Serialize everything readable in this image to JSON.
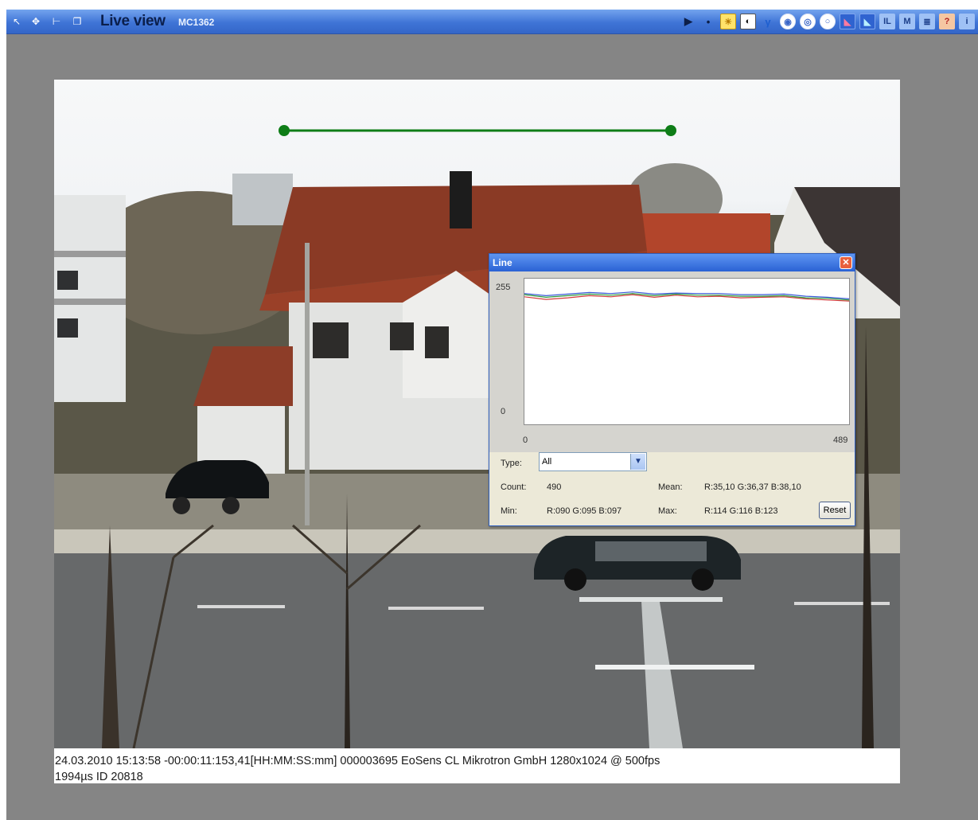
{
  "window": {
    "title": "Live view",
    "subtitle": "MC1362"
  },
  "toolbar_left": {
    "icons": [
      "pointer-icon",
      "move-icon",
      "line-measure-icon",
      "window-icon"
    ]
  },
  "toolbar_right": {
    "icons": [
      "play-icon",
      "record-dot-icon",
      "brightness-icon",
      "contrast-icon",
      "gamma-icon",
      "color-wheel-icon",
      "color-wheel-alt-icon",
      "white-balance-icon",
      "histogram-red-icon",
      "histogram-blue-icon",
      "line-profile-icon",
      "marker-icon",
      "list-icon",
      "help-icon",
      "info-icon"
    ]
  },
  "line_dialog": {
    "title": "Line",
    "close_glyph": "✕",
    "y_max_label": "255",
    "y_min_label": "0",
    "x_min_label": "0",
    "x_max_label": "489",
    "type_label": "Type:",
    "type_value": "All",
    "count_label": "Count:",
    "count_value": "490",
    "mean_label": "Mean:",
    "mean_value": "R:35,10 G:36,37 B:38,10",
    "min_label": "Min:",
    "min_value": "R:090 G:095 B:097",
    "max_label": "Max:",
    "max_value": "R:114 G:116 B:123",
    "reset_label": "Reset"
  },
  "status_bar": {
    "line1": "24.03.2010 15:13:58   -00:00:11:153,41[HH:MM:SS:mm]  000003695  EoSens CL    Mikrotron GmbH  1280x1024  @  500fps",
    "line2": "1994µs ID 20818"
  },
  "colors": {
    "measure_line": "#0e7d17",
    "series_red": "#d23a3a",
    "series_green": "#2e9a3e",
    "series_blue": "#3a59d8",
    "titlebar": "#3f74d6"
  },
  "chart_data": {
    "type": "line",
    "xlim": [
      0,
      489
    ],
    "ylim": [
      0,
      255
    ],
    "series": [
      {
        "color": "#d23a3a",
        "values": [
          230,
          225,
          228,
          232,
          230,
          234,
          229,
          233,
          230,
          231,
          228,
          229,
          230,
          226,
          224,
          222
        ]
      },
      {
        "color": "#2e9a3e",
        "values": [
          234,
          229,
          232,
          235,
          233,
          236,
          232,
          235,
          233,
          233,
          231,
          231,
          232,
          228,
          227,
          224
        ]
      },
      {
        "color": "#3a59d8",
        "values": [
          236,
          232,
          235,
          238,
          236,
          239,
          235,
          237,
          236,
          236,
          234,
          234,
          235,
          231,
          229,
          226
        ]
      }
    ]
  }
}
